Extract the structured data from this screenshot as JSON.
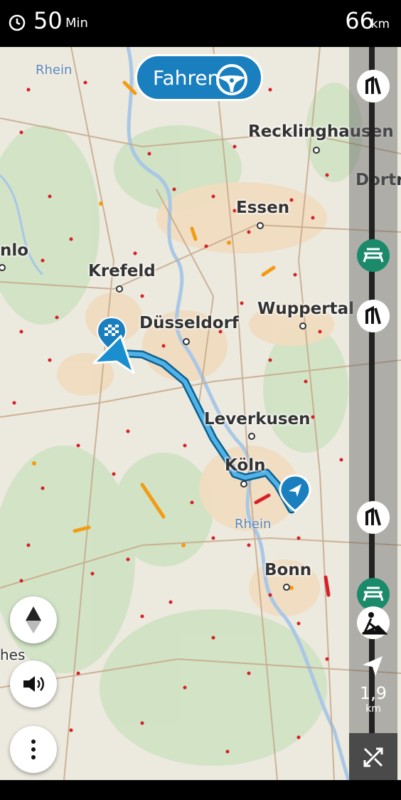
{
  "status": {
    "eta_value": "50",
    "eta_unit": "Min",
    "distance_value": "66",
    "distance_unit": "km"
  },
  "drive_button": {
    "label": "Fahren",
    "icon": "steering-wheel-icon"
  },
  "map": {
    "cities": {
      "recklinghausen": "Recklinghausen",
      "dortmund": "Dortr",
      "essen": "Essen",
      "venlo": "nlo",
      "krefeld": "Krefeld",
      "wuppertal": "Wuppertal",
      "duesseldorf": "Düsseldorf",
      "leverkusen": "Leverkusen",
      "koeln": "Köln",
      "bonn": "Bonn",
      "left_partial": "hes"
    },
    "rivers": {
      "rhein_top": "Rhein",
      "rhein_koeln": "Rhein"
    }
  },
  "sidebar": {
    "next_distance": "1,9",
    "next_distance_unit": "km",
    "icons": [
      "speed-camera-icon",
      "rest-area-icon",
      "speed-camera-icon",
      "speed-camera-icon",
      "rest-area-icon",
      "roadworks-icon",
      "direction-arrow-icon",
      "collapse-icon"
    ]
  },
  "controls": {
    "compass": "compass-icon",
    "sound": "speaker-icon",
    "menu": "more-icon"
  },
  "colors": {
    "route": "#2196d3",
    "accent": "#1a7fbf",
    "incident": "#d81f26"
  }
}
